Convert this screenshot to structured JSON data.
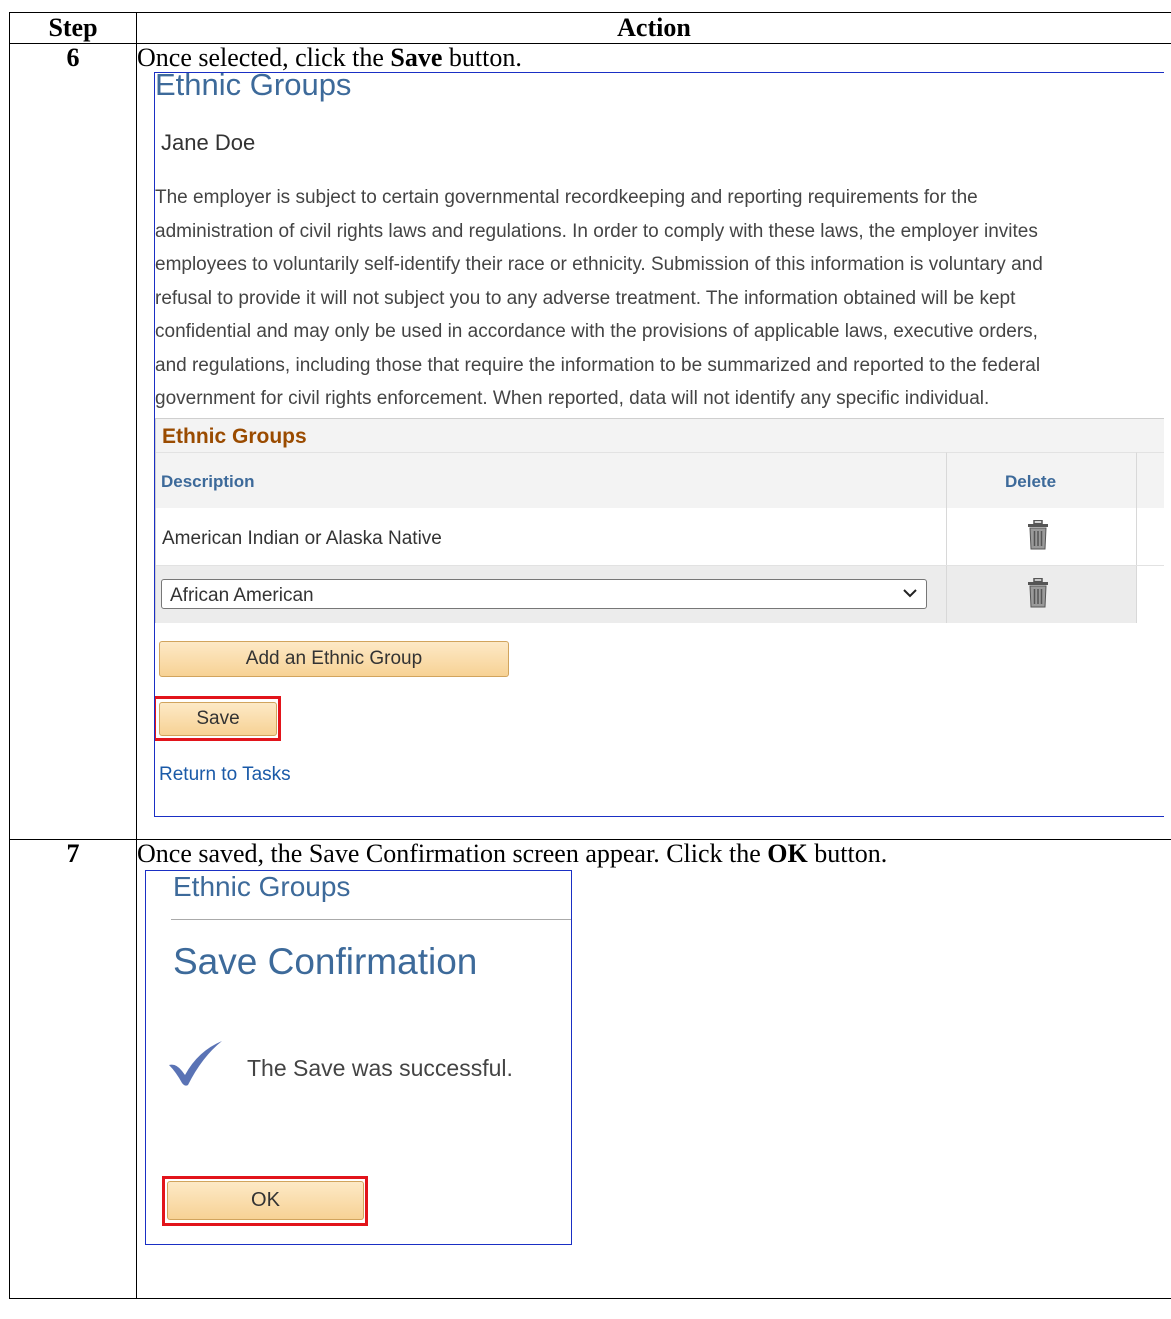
{
  "table": {
    "header_step": "Step",
    "header_action": "Action"
  },
  "step6": {
    "number": "6",
    "instruction_prefix": "Once selected, click the ",
    "instruction_bold": "Save",
    "instruction_suffix": " button.",
    "screen": {
      "title": "Ethnic Groups",
      "employee_name": "Jane Doe",
      "disclaimer_lines": [
        "The employer is subject to certain governmental recordkeeping and reporting requirements for the",
        "administration of civil rights laws and regulations. In order to comply with these laws, the employer invites",
        "employees to voluntarily self-identify their race or ethnicity. Submission of this information is voluntary and",
        "refusal to provide it will not subject you to any adverse treatment. The information obtained will be kept",
        "confidential and may only be used in accordance with the provisions of applicable laws, executive orders,",
        "and regulations, including those that require the information to be summarized and reported to the federal",
        "government for civil rights enforcement. When reported, data will not identify any specific individual."
      ],
      "grid_title": "Ethnic Groups",
      "col_description": "Description",
      "col_delete": "Delete",
      "row1_value": "American Indian or Alaska Native",
      "row2_selected": "African American",
      "add_button": "Add an Ethnic Group",
      "save_button": "Save",
      "return_link": "Return to Tasks",
      "highlight_color": "#e2141b"
    }
  },
  "step7": {
    "number": "7",
    "instruction_prefix": "Once saved, the Save Confirmation screen appear. Click the ",
    "instruction_bold": "OK",
    "instruction_suffix": " button.",
    "screen": {
      "title": "Ethnic Groups",
      "heading": "Save Confirmation",
      "check_icon": "checkmark-icon",
      "message": "The Save was successful.",
      "ok_button": "OK"
    }
  }
}
